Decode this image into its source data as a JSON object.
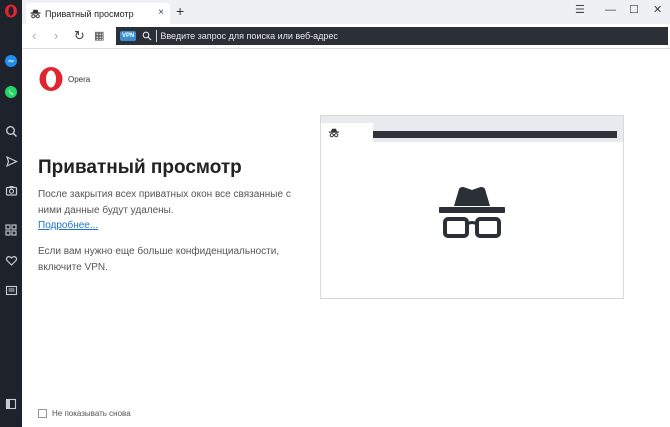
{
  "tab": {
    "title": "Приватный просмотр",
    "close": "×"
  },
  "newtab": "+",
  "window": {
    "menu": "☰",
    "minimize": "—",
    "maximize": "☐",
    "close": "✕"
  },
  "nav": {
    "back": "‹",
    "forward": "›",
    "reload": "↻",
    "grid": "▦"
  },
  "urlbar": {
    "vpn": "VPN",
    "placeholder": "Введите запрос для поиска или веб-адрес"
  },
  "logo": {
    "text": "Opera"
  },
  "content": {
    "heading": "Приватный просмотр",
    "para1": "После закрытия всех приватных окон все связанные с ними данные будут удалены.",
    "link": "Подробнее...",
    "para2": "Если вам нужно еще больше конфиденциальности, включите VPN."
  },
  "footer": {
    "checkbox_label": "Не показывать снова"
  },
  "colors": {
    "sidebar": "#1e232b",
    "opera_red": "#e0252f",
    "link": "#1a73c9",
    "vpn_badge": "#3a8fd1"
  }
}
